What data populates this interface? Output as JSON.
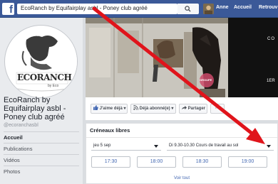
{
  "header": {
    "search_text": "EcoRanch  by Equifairplay asbl - Poney club agréé",
    "nav": [
      "Anne",
      "Accueil",
      "Retrouv"
    ]
  },
  "profile": {
    "logo_text": "ECORANCH",
    "logo_tag": "by Eco",
    "name": "EcoRanch by Equifairplay asbl - Poney club agréé",
    "handle": "@ecoranchasbl"
  },
  "sidebar": {
    "items": [
      {
        "label": "Accueil",
        "active": true
      },
      {
        "label": "Publications",
        "active": false
      },
      {
        "label": "Vidéos",
        "active": false
      },
      {
        "label": "Photos",
        "active": false
      }
    ]
  },
  "cover": {
    "text_top": "CO",
    "text_bottom": "1ER",
    "badge": "GROUPE"
  },
  "actions": {
    "like": "J'aime déjà",
    "follow": "Déjà abonné(e)",
    "share": "Partager",
    "more": "···"
  },
  "slots_card": {
    "title": "Créneaux libres",
    "date_select": "jeu 5 sep",
    "course_select": "Di 9.30-10.30 Cours de travail au sol",
    "times": [
      "17:30",
      "18:00",
      "18:30",
      "19:00"
    ],
    "see_all": "Voir tout"
  },
  "colors": {
    "facebook_blue": "#3b5998",
    "link_blue": "#4267b2",
    "arrow_red": "#e0141b"
  },
  "icons": [
    "facebook-logo-icon",
    "search-icon",
    "thumbs-up-icon",
    "rss-icon",
    "share-arrow-icon",
    "caret-down-icon"
  ]
}
